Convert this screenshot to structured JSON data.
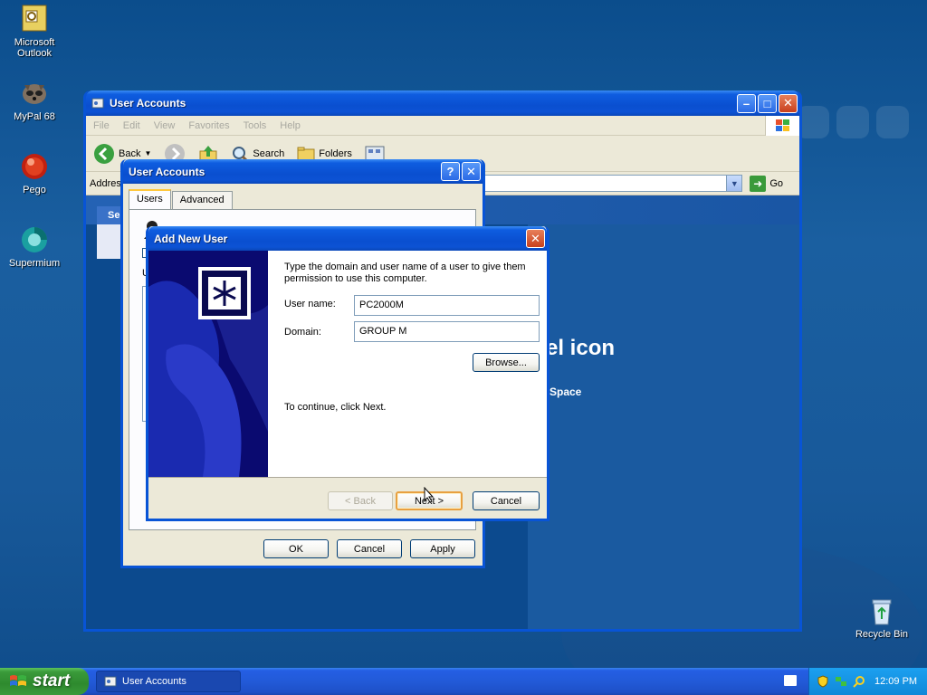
{
  "desktop": {
    "icons": [
      {
        "label": "Microsoft Outlook"
      },
      {
        "label": "MyPal 68"
      },
      {
        "label": "Pego"
      },
      {
        "label": "Supermium"
      },
      {
        "label": "Recycle Bin"
      }
    ]
  },
  "explorer": {
    "title": "User Accounts",
    "menu": [
      "File",
      "Edit",
      "View",
      "Favorites",
      "Tools",
      "Help"
    ],
    "toolbar": {
      "back": "Back",
      "search": "Search",
      "folders": "Folders"
    },
    "address_label": "Addres",
    "go_label": "Go",
    "pane_title": "Se",
    "heading": "el icon",
    "subheading": "Space"
  },
  "user_accounts_dialog": {
    "title": "User Accounts",
    "tabs": [
      "Users",
      "Advanced"
    ],
    "buttons": {
      "ok": "OK",
      "cancel": "Cancel",
      "apply": "Apply"
    },
    "panel_fragment": "U"
  },
  "add_new_user_dialog": {
    "title": "Add New User",
    "instructions": "Type the domain and user name of a user to give them permission to use this computer.",
    "username_label": "User name:",
    "username_value": "PC2000M",
    "domain_label": "Domain:",
    "domain_value": "GROUP M",
    "browse_label": "Browse...",
    "continue_text": "To continue, click Next.",
    "buttons": {
      "back": "< Back",
      "next": "Next >",
      "cancel": "Cancel"
    }
  },
  "taskbar": {
    "start_label": "start",
    "window_item": "User Accounts",
    "clock": "12:09 PM"
  },
  "colors": {
    "xp_blue": "#0854d6",
    "desktop": "#18599a",
    "dialog_face": "#ece9d8",
    "start_green": "#3a9a3a"
  }
}
